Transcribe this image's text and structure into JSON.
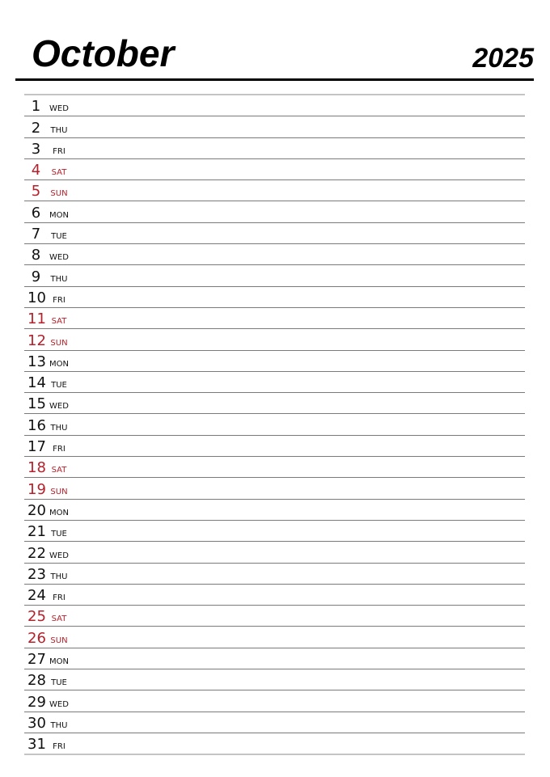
{
  "header": {
    "month": "October",
    "year": "2025"
  },
  "colors": {
    "weekday_text": "#111111",
    "weekend_text": "#b5202a"
  },
  "days": [
    {
      "day": "1",
      "dow": "WED",
      "weekend": false
    },
    {
      "day": "2",
      "dow": "THU",
      "weekend": false
    },
    {
      "day": "3",
      "dow": "FRI",
      "weekend": false
    },
    {
      "day": "4",
      "dow": "SAT",
      "weekend": true
    },
    {
      "day": "5",
      "dow": "SUN",
      "weekend": true
    },
    {
      "day": "6",
      "dow": "MON",
      "weekend": false
    },
    {
      "day": "7",
      "dow": "TUE",
      "weekend": false
    },
    {
      "day": "8",
      "dow": "WED",
      "weekend": false
    },
    {
      "day": "9",
      "dow": "THU",
      "weekend": false
    },
    {
      "day": "10",
      "dow": "FRI",
      "weekend": false
    },
    {
      "day": "11",
      "dow": "SAT",
      "weekend": true
    },
    {
      "day": "12",
      "dow": "SUN",
      "weekend": true
    },
    {
      "day": "13",
      "dow": "MON",
      "weekend": false
    },
    {
      "day": "14",
      "dow": "TUE",
      "weekend": false
    },
    {
      "day": "15",
      "dow": "WED",
      "weekend": false
    },
    {
      "day": "16",
      "dow": "THU",
      "weekend": false
    },
    {
      "day": "17",
      "dow": "FRI",
      "weekend": false
    },
    {
      "day": "18",
      "dow": "SAT",
      "weekend": true
    },
    {
      "day": "19",
      "dow": "SUN",
      "weekend": true
    },
    {
      "day": "20",
      "dow": "MON",
      "weekend": false
    },
    {
      "day": "21",
      "dow": "TUE",
      "weekend": false
    },
    {
      "day": "22",
      "dow": "WED",
      "weekend": false
    },
    {
      "day": "23",
      "dow": "THU",
      "weekend": false
    },
    {
      "day": "24",
      "dow": "FRI",
      "weekend": false
    },
    {
      "day": "25",
      "dow": "SAT",
      "weekend": true
    },
    {
      "day": "26",
      "dow": "SUN",
      "weekend": true
    },
    {
      "day": "27",
      "dow": "MON",
      "weekend": false
    },
    {
      "day": "28",
      "dow": "TUE",
      "weekend": false
    },
    {
      "day": "29",
      "dow": "WED",
      "weekend": false
    },
    {
      "day": "30",
      "dow": "THU",
      "weekend": false
    },
    {
      "day": "31",
      "dow": "FRI",
      "weekend": false
    }
  ]
}
